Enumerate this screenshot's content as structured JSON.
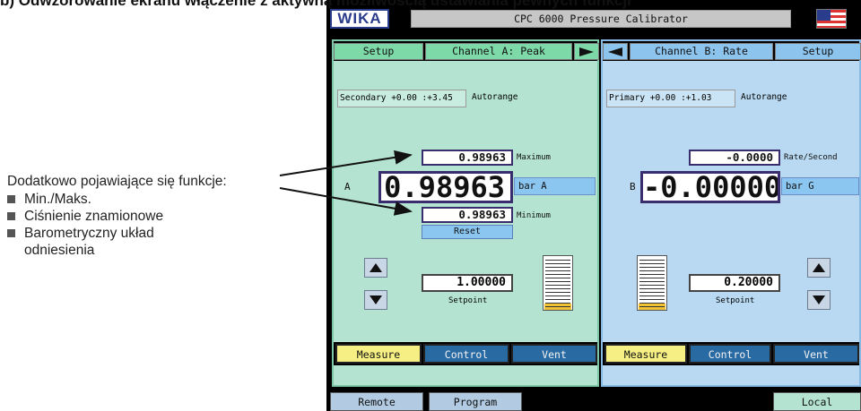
{
  "page_heading": "b) Odwzorowanie ekranu włączenie z aktywną możliwością ustawiania pewnych funkcji",
  "annotation": {
    "intro": "Dodatkowo pojawiające się funkcje:",
    "items": [
      "Min./Maks.",
      "Ciśnienie znamionowe",
      "Barometryczny układ odniesienia"
    ]
  },
  "device": {
    "logo": "WIKA",
    "title": "CPC 6000 Pressure Calibrator",
    "flag_icon": "us-flag-icon",
    "channel_a": {
      "setup_label": "Setup",
      "channel_label": "Channel A: Peak",
      "arrow_icon": "arrow-right-icon",
      "secondary_field": "Secondary +0.00 :+3.45",
      "autorange_label": "Autorange",
      "maximum_value": "0.98963",
      "maximum_label": "Maximum",
      "channel_letter": "A",
      "main_value": "0.98963",
      "unit": "bar A",
      "minimum_value": "0.98963",
      "minimum_label": "Minimum",
      "reset_label": "Reset",
      "setpoint_value": "1.00000",
      "setpoint_label": "Setpoint",
      "bargraph_level": 0.12,
      "modes": {
        "measure": "Measure",
        "control": "Control",
        "vent": "Vent"
      }
    },
    "channel_b": {
      "arrow_icon": "arrow-left-icon",
      "channel_label": "Channel B: Rate",
      "setup_label": "Setup",
      "primary_field": "Primary +0.00 :+1.03",
      "autorange_label": "Autorange",
      "rate_value": "-0.0000",
      "rate_label": "Rate/Second",
      "channel_letter": "B",
      "main_value": "-0.00000",
      "unit": "bar G",
      "setpoint_value": "0.20000",
      "setpoint_label": "Setpoint",
      "bargraph_level": 0.12,
      "modes": {
        "measure": "Measure",
        "control": "Control",
        "vent": "Vent"
      }
    },
    "bottom": {
      "remote": "Remote",
      "program": "Program",
      "local": "Local"
    },
    "colors": {
      "panel_a_bg": "#b4e3d2",
      "panel_b_bg": "#b8d9f1",
      "measure_active": "#f6ef83",
      "mode_inactive": "#2a6aa3",
      "bargraph_fill": "#f0c234"
    }
  }
}
